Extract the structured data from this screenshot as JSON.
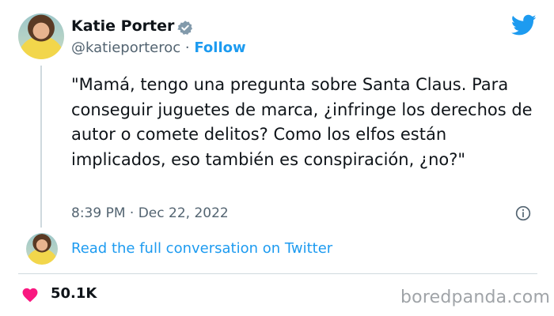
{
  "author": {
    "name": "Katie Porter",
    "handle": "@katieporteroc",
    "separator": "·",
    "follow_label": "Follow"
  },
  "tweet": {
    "text": "\"Mamá, tengo una pregunta sobre Santa Claus. Para conseguir juguetes de marca, ¿infringe los derechos de autor o comete delitos? Como los elfos están implicados, eso también es conspiración, ¿no?\"",
    "timestamp": "8:39 PM · Dec 22, 2022"
  },
  "conversation_link": "Read the full conversation on Twitter",
  "engagement": {
    "likes": "50.1K"
  },
  "watermark": "boredpanda.com",
  "colors": {
    "accent": "#1d9bf0",
    "heart": "#f91880",
    "muted": "#536471"
  },
  "icons": {
    "brand": "twitter-bird-icon",
    "verified": "verified-badge-icon",
    "info": "info-icon",
    "like": "heart-icon"
  }
}
